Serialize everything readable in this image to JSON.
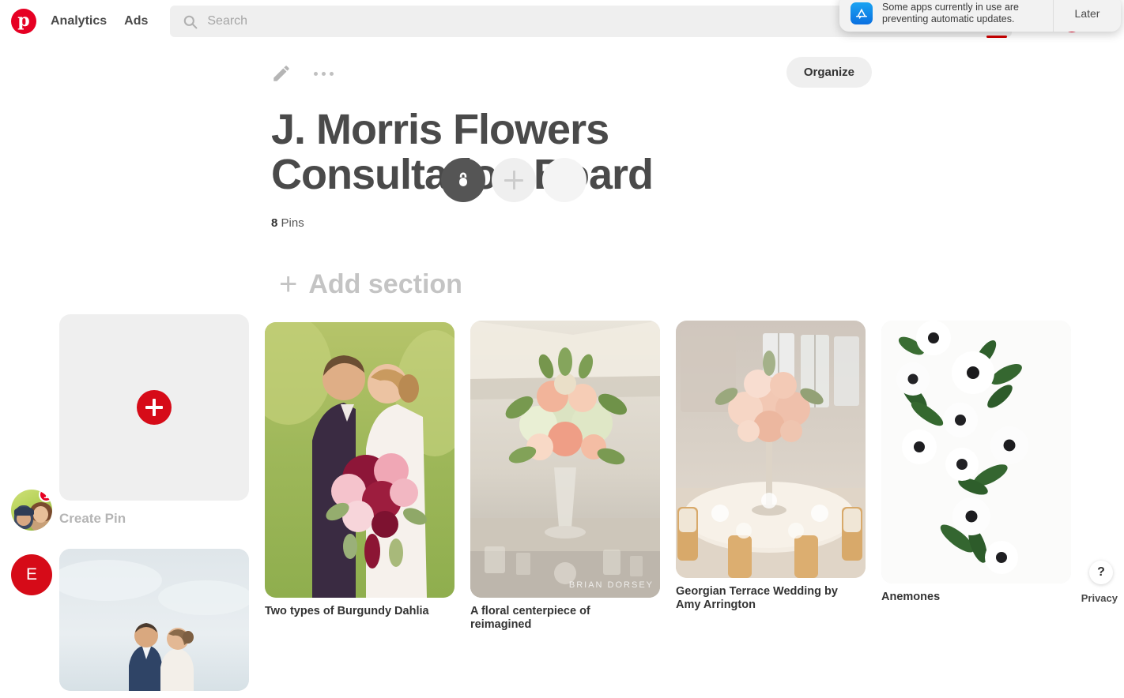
{
  "header": {
    "logo_name": "pinterest-logo",
    "nav": [
      {
        "label": "Analytics",
        "name": "nav-analytics"
      },
      {
        "label": "Ads",
        "name": "nav-ads"
      }
    ],
    "search": {
      "placeholder": "Search",
      "value": "",
      "icon": "search-icon"
    }
  },
  "board": {
    "edit_icon": "pencil-icon",
    "more_icon": "more-dots-icon",
    "organize_label": "Organize",
    "title": "J. Morris Flowers Consultation Board",
    "pins_count": "8",
    "pins_label": "Pins",
    "lock_icon": "lock-icon",
    "add_collaborator_icon": "plus-icon",
    "add_section_plus": "+",
    "add_section_label": "Add section"
  },
  "left_rail": {
    "avatar_name": "user-avatar",
    "avatar_badge": "1",
    "secondary_avatar_initial": "E"
  },
  "pins": [
    {
      "name": "create-pin-card",
      "title": "Create Pin",
      "type": "create",
      "muted": true
    },
    {
      "name": "pin-card-wedding-couple",
      "title": "",
      "type": "photo",
      "subject": "wedding-couple-sky"
    },
    {
      "name": "pin-card-burgundy-dahlia",
      "title": "Two types of Burgundy Dahlia",
      "type": "photo",
      "subject": "bride-groom-kiss-bouquet"
    },
    {
      "name": "pin-card-floral-centerpiece",
      "title": "A floral centerpiece of reimagined",
      "type": "photo",
      "subject": "tall-centerpiece-reception",
      "watermark": "BRIAN DORSEY"
    },
    {
      "name": "pin-card-georgian-terrace",
      "title": "Georgian Terrace Wedding by Amy Arrington",
      "type": "photo",
      "subject": "ballroom-tall-centerpiece"
    },
    {
      "name": "pin-card-anemones",
      "title": "Anemones",
      "type": "photo",
      "subject": "white-anemone-flatlay"
    }
  ],
  "footer": {
    "help_glyph": "?",
    "privacy_label": "Privacy"
  },
  "notification": {
    "app_icon": "app-store-icon",
    "message": "Some apps currently in use are preventing automatic updates.",
    "action_label": "Later"
  },
  "colors": {
    "brand_red": "#e60023",
    "text_dark": "#4a4a4a",
    "muted": "#c4c4c4",
    "surface": "#efefef"
  }
}
